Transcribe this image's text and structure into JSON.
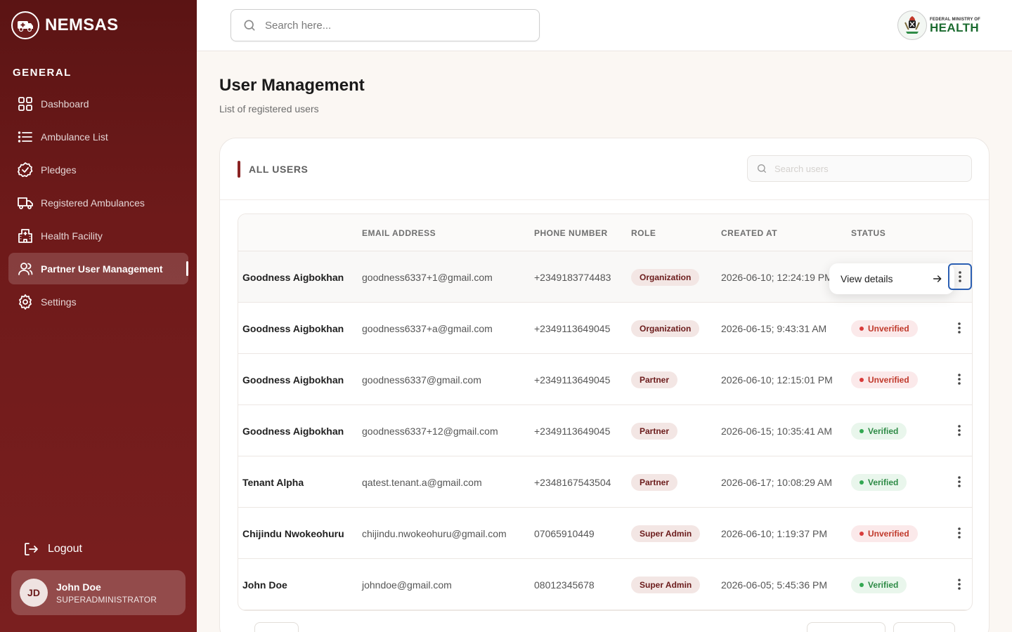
{
  "brand": {
    "name": "NEMSAS",
    "logo_icon": "ambulance-icon"
  },
  "sidebar": {
    "heading": "GENERAL",
    "items": [
      {
        "label": "Dashboard",
        "icon": "grid-icon",
        "active": false
      },
      {
        "label": "Ambulance List",
        "icon": "list-icon",
        "active": false
      },
      {
        "label": "Pledges",
        "icon": "badge-check-icon",
        "active": false
      },
      {
        "label": "Registered Ambulances",
        "icon": "truck-icon",
        "active": false
      },
      {
        "label": "Health Facility",
        "icon": "hospital-icon",
        "active": false
      },
      {
        "label": "Partner User Management",
        "icon": "users-icon",
        "active": true
      },
      {
        "label": "Settings",
        "icon": "gear-icon",
        "active": false
      }
    ],
    "logout_label": "Logout",
    "user": {
      "initials": "JD",
      "name": "John Doe",
      "role": "SUPERADMINISTRATOR"
    }
  },
  "topbar": {
    "search_placeholder": "Search here...",
    "ministry": {
      "line1": "FEDERAL MINISTRY OF",
      "line2": "HEALTH"
    }
  },
  "page": {
    "title": "User Management",
    "subtitle": "List of registered users"
  },
  "card": {
    "title": "ALL USERS",
    "search_placeholder": "Search users"
  },
  "table": {
    "columns": [
      "",
      "EMAIL ADDRESS",
      "PHONE NUMBER",
      "ROLE",
      "CREATED AT",
      "STATUS"
    ],
    "rows": [
      {
        "name": "Goodness Aigbokhan",
        "email": "goodness6337+1@gmail.com",
        "phone": "+2349183774483",
        "role": "Organization",
        "created": "2026-06-10; 12:24:19 PM",
        "status": ""
      },
      {
        "name": "Goodness Aigbokhan",
        "email": "goodness6337+a@gmail.com",
        "phone": "+2349113649045",
        "role": "Organization",
        "created": "2026-06-15; 9:43:31 AM",
        "status": "Unverified"
      },
      {
        "name": "Goodness Aigbokhan",
        "email": "goodness6337@gmail.com",
        "phone": "+2349113649045",
        "role": "Partner",
        "created": "2026-06-10; 12:15:01 PM",
        "status": "Unverified"
      },
      {
        "name": "Goodness Aigbokhan",
        "email": "goodness6337+12@gmail.com",
        "phone": "+2349113649045",
        "role": "Partner",
        "created": "2026-06-15; 10:35:41 AM",
        "status": "Verified"
      },
      {
        "name": "Tenant Alpha",
        "email": "qatest.tenant.a@gmail.com",
        "phone": "+2348167543504",
        "role": "Partner",
        "created": "2026-06-17; 10:08:29 AM",
        "status": "Verified"
      },
      {
        "name": "Chijindu Nwokeohuru",
        "email": "chijindu.nwokeohuru@gmail.com",
        "phone": "07065910449",
        "role": "Super Admin",
        "created": "2026-06-10; 1:19:37 PM",
        "status": "Unverified"
      },
      {
        "name": "John Doe",
        "email": "johndoe@gmail.com",
        "phone": "08012345678",
        "role": "Super Admin",
        "created": "2026-06-05; 5:45:36 PM",
        "status": "Verified"
      }
    ],
    "popup_label": "View details",
    "status_colors": {
      "Verified": "#33a852",
      "Unverified": "#d93b3b"
    }
  },
  "colors": {
    "brand": "#6e1a1a",
    "accent_bar": "#8a2323",
    "focus": "#2b5fb3"
  }
}
